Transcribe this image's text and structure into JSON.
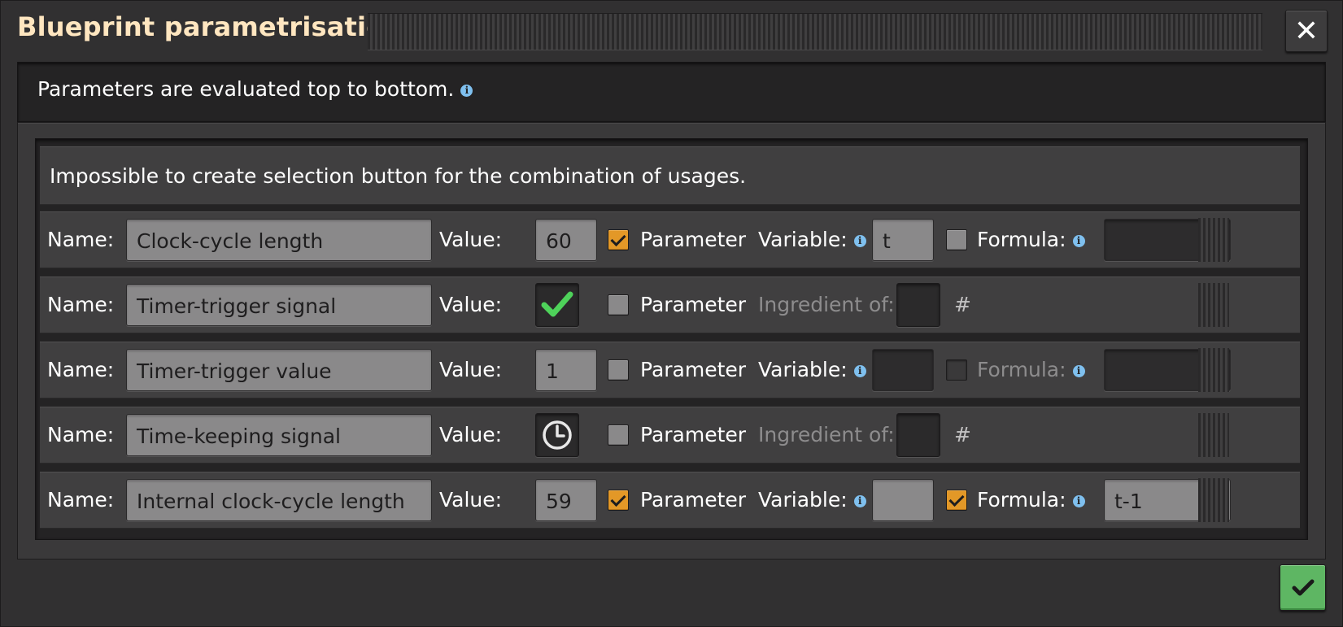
{
  "window": {
    "title": "Blueprint parametrisation",
    "close_symbol": "✕"
  },
  "info": {
    "text": "Parameters are evaluated top to bottom.",
    "icon": "info-icon"
  },
  "warning": {
    "text": "Impossible to create selection button for the combination of usages."
  },
  "labels": {
    "name": "Name:",
    "value": "Value:",
    "parameter": "Parameter",
    "variable": "Variable:",
    "formula": "Formula:",
    "ingredient_of": "Ingredient of:",
    "hash": "#"
  },
  "rows": [
    {
      "kind": "number",
      "name": "Clock-cycle length",
      "value": "60",
      "parameter_checked": true,
      "variable": "t",
      "formula_checked": false,
      "formula_enabled": true,
      "formula": ""
    },
    {
      "kind": "signal",
      "name": "Timer-trigger signal",
      "value_icon": "green-check-signal-icon",
      "parameter_checked": false,
      "ingredient_of": ""
    },
    {
      "kind": "number",
      "name": "Timer-trigger value",
      "value": "1",
      "parameter_checked": false,
      "variable": "",
      "formula_checked": false,
      "formula_enabled": false,
      "formula": ""
    },
    {
      "kind": "signal",
      "name": "Time-keeping signal",
      "value_icon": "clock-signal-icon",
      "parameter_checked": false,
      "ingredient_of": ""
    },
    {
      "kind": "number",
      "name": "Internal clock-cycle length",
      "value": "59",
      "parameter_checked": true,
      "variable": "",
      "formula_checked": true,
      "formula_enabled": true,
      "formula": "t-1"
    }
  ],
  "colors": {
    "title": "#ffe6c0",
    "checkbox_checked": "#e39827",
    "confirm_button": "#5eb663",
    "info_icon": "#7fc0ef",
    "check_signal": "#4ed25a"
  },
  "confirm_button": {
    "icon": "checkmark-icon"
  }
}
